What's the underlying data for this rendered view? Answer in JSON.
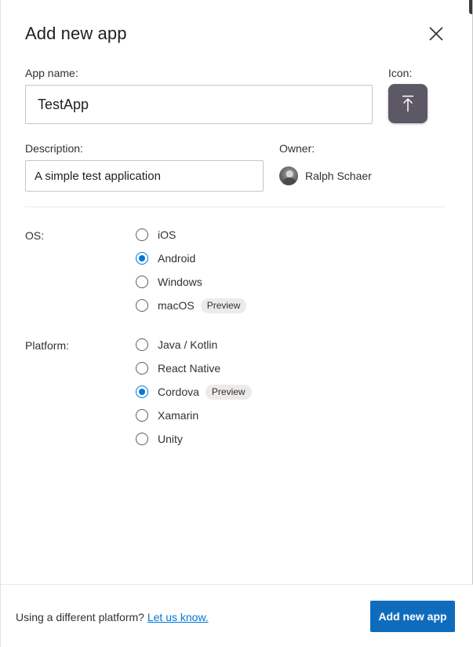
{
  "dialog": {
    "title": "Add new app",
    "close_icon": "close-icon"
  },
  "form": {
    "app_name_label": "App name:",
    "app_name_value": "TestApp",
    "icon_label": "Icon:",
    "upload_icon": "upload-icon",
    "description_label": "Description:",
    "description_value": "A simple test application",
    "owner_label": "Owner:",
    "owner_name": "Ralph Schaer"
  },
  "os": {
    "label": "OS:",
    "options": [
      {
        "label": "iOS",
        "selected": false,
        "badge": ""
      },
      {
        "label": "Android",
        "selected": true,
        "badge": ""
      },
      {
        "label": "Windows",
        "selected": false,
        "badge": ""
      },
      {
        "label": "macOS",
        "selected": false,
        "badge": "Preview"
      }
    ]
  },
  "platform": {
    "label": "Platform:",
    "options": [
      {
        "label": "Java / Kotlin",
        "selected": false,
        "badge": ""
      },
      {
        "label": "React Native",
        "selected": false,
        "badge": ""
      },
      {
        "label": "Cordova",
        "selected": true,
        "badge": "Preview"
      },
      {
        "label": "Xamarin",
        "selected": false,
        "badge": ""
      },
      {
        "label": "Unity",
        "selected": false,
        "badge": ""
      }
    ]
  },
  "footer": {
    "prompt_text": "Using a different platform?",
    "link_text": "Let us know.",
    "submit_label": "Add new app"
  },
  "colors": {
    "accent": "#0078d4",
    "button": "#0f6cbd",
    "icon_tile": "#5c5866"
  }
}
